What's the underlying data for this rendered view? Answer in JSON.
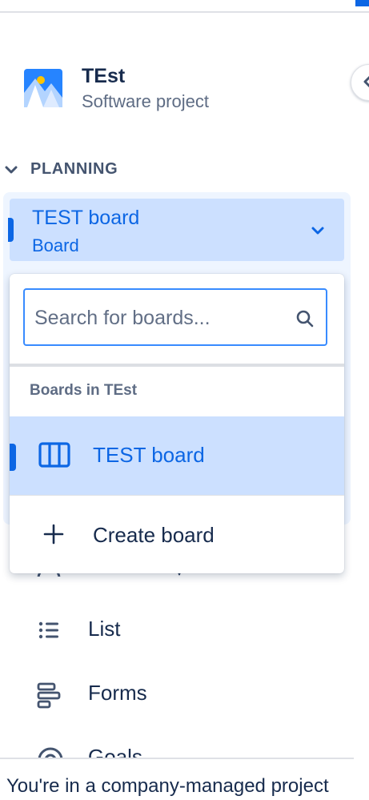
{
  "project": {
    "name": "TEst",
    "type": "Software project"
  },
  "planning": {
    "label": "PLANNING"
  },
  "board_selector": {
    "name": "TEST board",
    "type": "Board"
  },
  "dropdown": {
    "search_placeholder": "Search for boards...",
    "section_title": "Boards in TEst",
    "boards": [
      {
        "label": "TEST board"
      }
    ],
    "create_label": "Create board"
  },
  "nav": {
    "items": [
      {
        "label": "List",
        "icon": "list-icon"
      },
      {
        "label": "Forms",
        "icon": "forms-icon"
      },
      {
        "label": "Goals",
        "icon": "goals-icon"
      }
    ]
  },
  "footer": {
    "text": "You're in a company-managed project"
  },
  "colors": {
    "accent": "#0c66e4",
    "selected_bg": "#cce0ff",
    "text": "#172b4d",
    "subtle_text": "#5e6c84",
    "focus_border": "#388bff"
  }
}
